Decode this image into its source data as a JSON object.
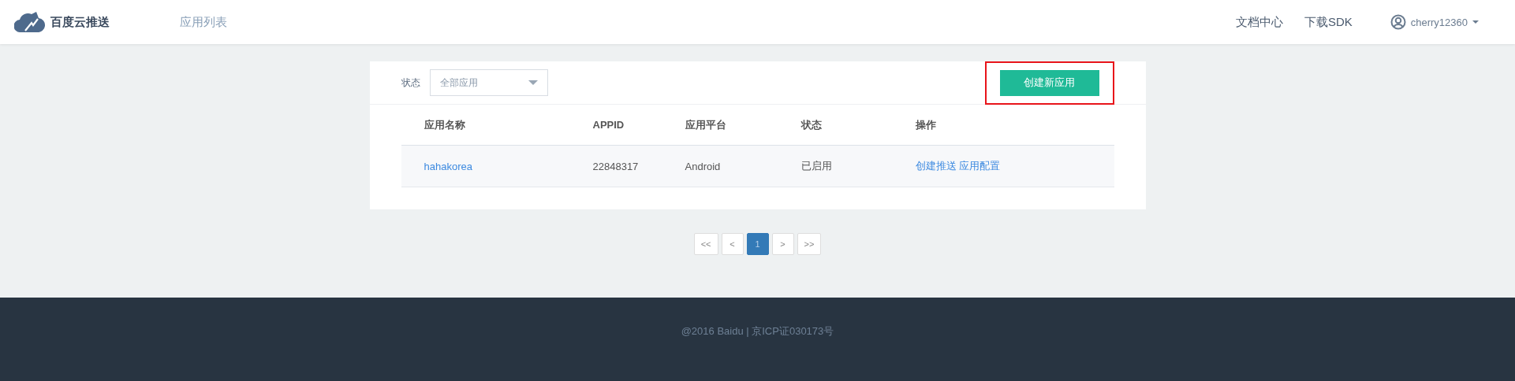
{
  "header": {
    "brand": "百度云推送",
    "nav": [
      {
        "label": "应用列表",
        "selected": false
      }
    ],
    "links": [
      "文档中心",
      "下载SDK"
    ],
    "user": "cherry12360"
  },
  "filter": {
    "label": "状态",
    "value": "全部应用"
  },
  "create_button": {
    "label": "创建新应用",
    "highlighted": true
  },
  "table": {
    "columns": [
      "应用名称",
      "APPID",
      "应用平台",
      "状态",
      "操作"
    ],
    "rows": [
      {
        "name": "hahakorea",
        "appid": "22848317",
        "platform": "Android",
        "status": "已启用",
        "actions": [
          "创建推送",
          "应用配置"
        ]
      }
    ]
  },
  "pagination": [
    {
      "label": "<<",
      "selected": false
    },
    {
      "label": "<",
      "selected": false
    },
    {
      "label": "1",
      "selected": true
    },
    {
      "label": ">",
      "selected": false
    },
    {
      "label": ">>",
      "selected": false
    }
  ],
  "footer": "@2016 Baidu | 京ICP证030173号"
}
